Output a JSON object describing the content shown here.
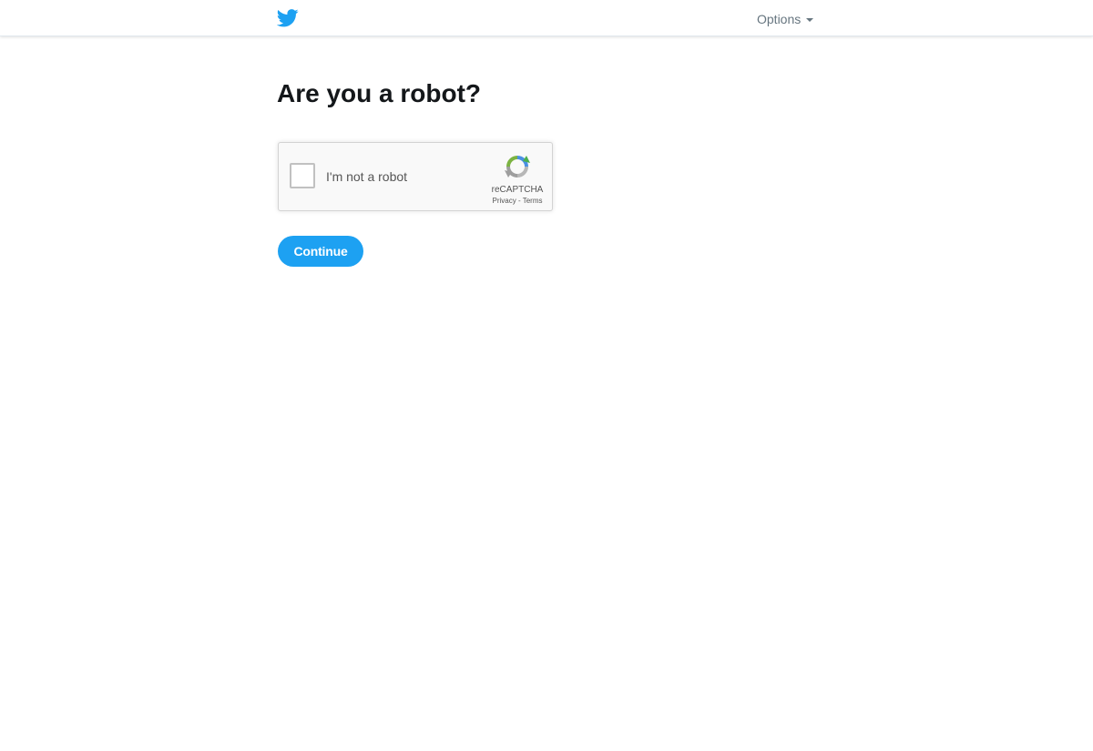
{
  "header": {
    "logo_icon": "twitter-bird-icon",
    "options_label": "Options",
    "options_icon": "caret-down-icon"
  },
  "main": {
    "title": "Are you a robot?",
    "recaptcha": {
      "checkbox_label": "I'm not a robot",
      "checked": false,
      "brand": "reCAPTCHA",
      "privacy_link": "Privacy",
      "separator": " - ",
      "terms_link": "Terms",
      "logo_icon": "recaptcha-logo-icon"
    },
    "continue_label": "Continue"
  },
  "colors": {
    "brand_blue": "#1da1f2",
    "heading_text": "#14171a",
    "muted_text": "#66757f"
  }
}
